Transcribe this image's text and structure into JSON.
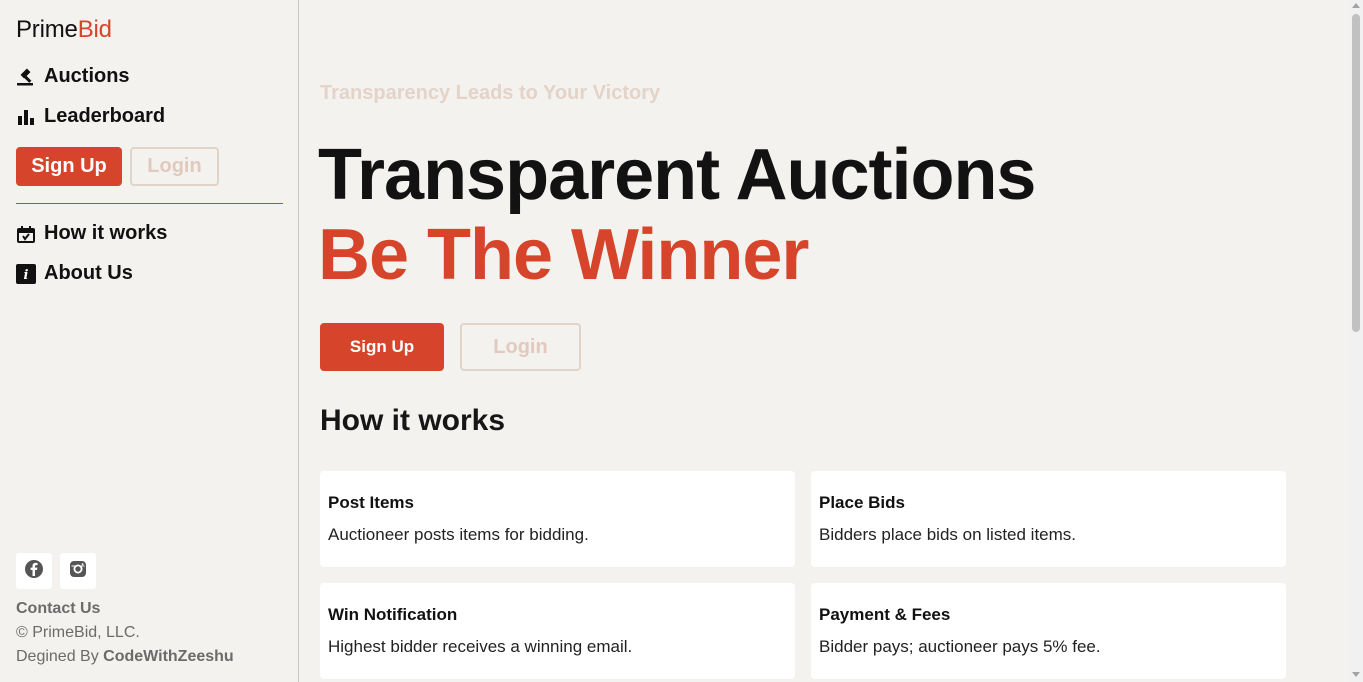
{
  "brand": {
    "name_part1": "Prime",
    "name_part2": "Bid",
    "accent_color": "#d6452b"
  },
  "sidebar": {
    "nav": [
      {
        "label": "Auctions",
        "icon": "gavel-icon"
      },
      {
        "label": "Leaderboard",
        "icon": "bar-chart-icon"
      }
    ],
    "signup_label": "Sign Up",
    "login_label": "Login",
    "info_nav": [
      {
        "label": "How it works",
        "icon": "calendar-box-icon"
      },
      {
        "label": "About Us",
        "icon": "info-icon"
      }
    ],
    "social": [
      "facebook-icon",
      "instagram-icon"
    ],
    "contact_label": "Contact Us",
    "copyright": "© PrimeBid, LLC.",
    "designed_prefix": "Degined By",
    "designed_by": "CodeWithZeeshu"
  },
  "hero": {
    "tagline": "Transparency Leads to Your Victory",
    "title_line1": "Transparent Auctions",
    "title_line2": "Be The Winner",
    "signup_label": "Sign Up",
    "login_label": "Login"
  },
  "how_it_works": {
    "title": "How it works",
    "cards": [
      {
        "title": "Post Items",
        "text": "Auctioneer posts items for bidding."
      },
      {
        "title": "Place Bids",
        "text": "Bidders place bids on listed items."
      },
      {
        "title": "Win Notification",
        "text": "Highest bidder receives a winning email."
      },
      {
        "title": "Payment & Fees",
        "text": "Bidder pays; auctioneer pays 5% fee."
      }
    ]
  }
}
